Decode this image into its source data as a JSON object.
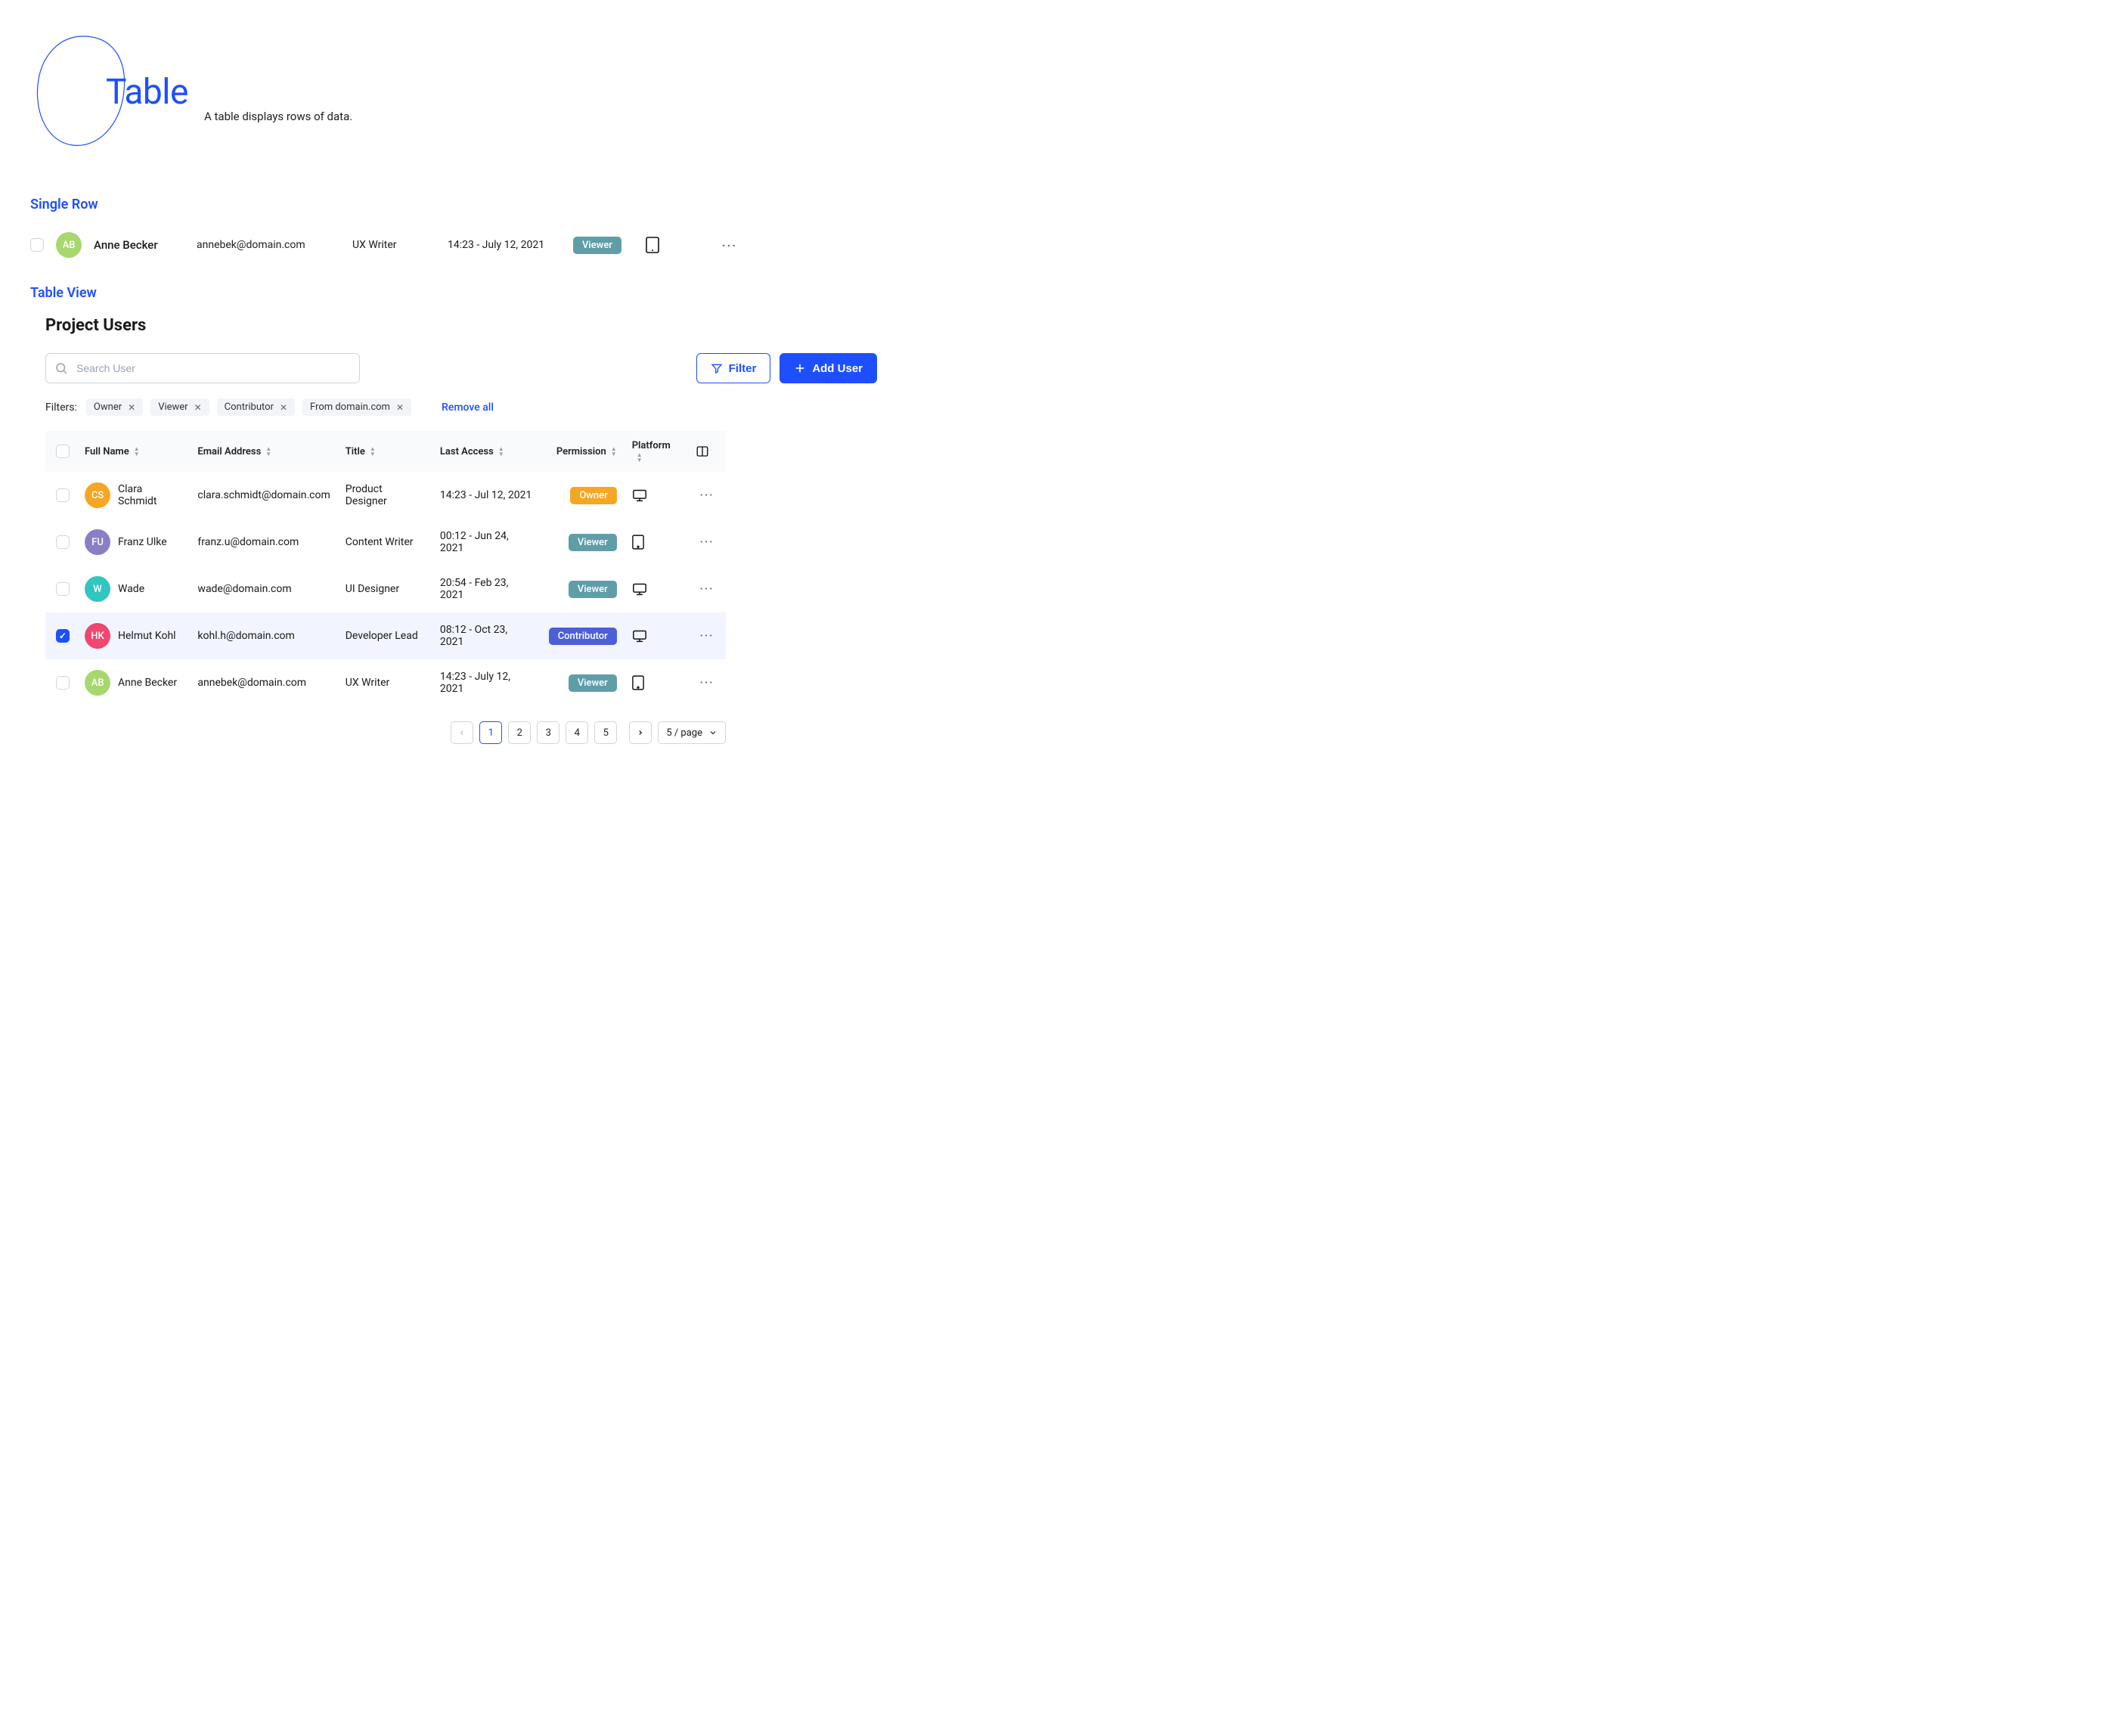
{
  "header": {
    "title": "Table",
    "description": "A table displays rows of data."
  },
  "sections": {
    "single_row": "Single Row",
    "table_view": "Table View"
  },
  "single_row": {
    "avatar_initials": "AB",
    "avatar_color": "#a7d86e",
    "name": "Anne Becker",
    "email": "annebek@domain.com",
    "title": "UX Writer",
    "last_access": "14:23 - July 12, 2021",
    "permission": "Viewer",
    "platform": "tablet"
  },
  "table": {
    "heading": "Project Users",
    "search_placeholder": "Search User",
    "filter_button": "Filter",
    "add_user_button": "Add User",
    "filters_label": "Filters:",
    "filters": [
      "Owner",
      "Viewer",
      "Contributor",
      "From domain.com"
    ],
    "remove_all": "Remove all",
    "columns": {
      "full_name": "Full Name",
      "email": "Email Address",
      "title": "Title",
      "last_access": "Last Access",
      "permission": "Permission",
      "platform": "Platform"
    },
    "rows": [
      {
        "initials": "CS",
        "avatar_color": "#f5a623",
        "name": "Clara Schmidt",
        "email": "clara.schmidt@domain.com",
        "title": "Product Designer",
        "last_access": "14:23 - Jul 12, 2021",
        "permission": "Owner",
        "permission_class": "badge-owner",
        "platform": "desktop",
        "selected": false
      },
      {
        "initials": "FU",
        "avatar_color": "#8a7fc7",
        "name": "Franz Ulke",
        "email": "franz.u@domain.com",
        "title": "Content Writer",
        "last_access": "00:12 - Jun 24, 2021",
        "permission": "Viewer",
        "permission_class": "badge-viewer",
        "platform": "tablet",
        "selected": false
      },
      {
        "initials": "W",
        "avatar_color": "#30c6c1",
        "name": "Wade",
        "email": "wade@domain.com",
        "title": "UI Designer",
        "last_access": "20:54 - Feb 23, 2021",
        "permission": "Viewer",
        "permission_class": "badge-viewer",
        "platform": "desktop",
        "selected": false
      },
      {
        "initials": "HK",
        "avatar_color": "#ef476f",
        "name": "Helmut Kohl",
        "email": "kohl.h@domain.com",
        "title": "Developer Lead",
        "last_access": "08:12 - Oct 23, 2021",
        "permission": "Contributor",
        "permission_class": "badge-contributor",
        "platform": "desktop",
        "selected": true
      },
      {
        "initials": "AB",
        "avatar_color": "#a7d86e",
        "name": "Anne Becker",
        "email": "annebek@domain.com",
        "title": "UX Writer",
        "last_access": "14:23 - July 12, 2021",
        "permission": "Viewer",
        "permission_class": "badge-viewer",
        "platform": "tablet",
        "selected": false
      }
    ],
    "pagination": {
      "pages": [
        "1",
        "2",
        "3",
        "4",
        "5"
      ],
      "active": "1",
      "page_size_label": "5 / page"
    }
  }
}
